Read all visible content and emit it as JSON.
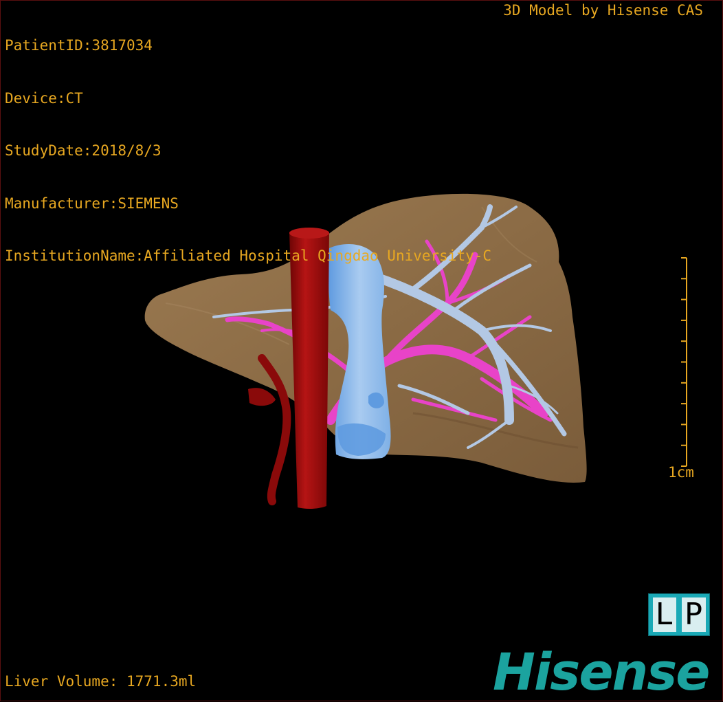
{
  "patient_info": {
    "patient_id": "PatientID:3817034",
    "device": "Device:CT",
    "study_date": "StudyDate:2018/8/3",
    "manufacturer": "Manufacturer:SIEMENS",
    "institution": "InstitutionName:Affiliated Hospital Qingdao University-C"
  },
  "brand_credit": "3D Model by Hisense CAS",
  "volume_readout": "Liver Volume: 1771.3ml",
  "scale_bar": {
    "label": "1cm",
    "ticks": 11
  },
  "orientation": {
    "left_letter": "L",
    "right_letter": "P"
  },
  "logo_text": "Hisense",
  "colors": {
    "overlay_text": "#e8a821",
    "liver": "#8b6b45",
    "aorta": "#a10d0d",
    "vena_cava": "#9cc3ec",
    "portal_vein": "#e843c8",
    "hepatic_vein": "#b3c8e4",
    "logo": "#1ba39f"
  }
}
